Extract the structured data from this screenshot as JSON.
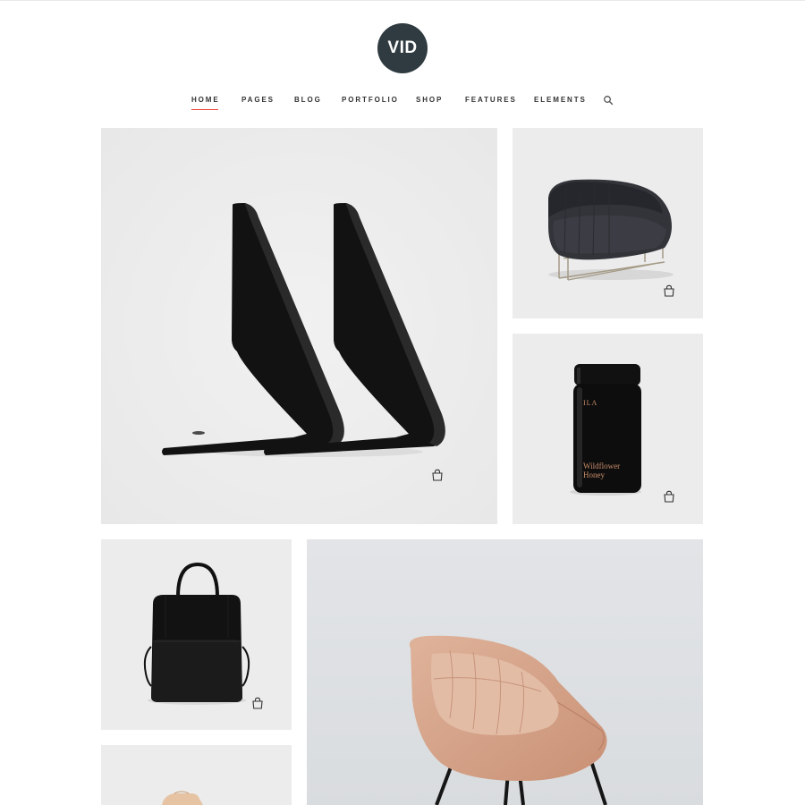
{
  "brand": {
    "logo_text": "VID",
    "logo_color": "#2f3b40"
  },
  "nav": {
    "items": [
      {
        "label": "HOME",
        "active": true
      },
      {
        "label": "PAGES",
        "active": false
      },
      {
        "label": "BLOG",
        "active": false
      },
      {
        "label": "PORTFOLIO",
        "active": false
      },
      {
        "label": "SHOP",
        "active": false
      },
      {
        "label": "FEATURES",
        "active": false
      },
      {
        "label": "ELEMENTS",
        "active": false
      }
    ],
    "active_underline_color": "#e84b3c",
    "search_icon": "search-icon"
  },
  "products": [
    {
      "name": "black-bookends",
      "icon": "shopping-bag-icon"
    },
    {
      "name": "dark-armchair",
      "icon": "shopping-bag-icon"
    },
    {
      "name": "honey-jar",
      "icon": "shopping-bag-icon",
      "jar_label": {
        "brand": "ILA",
        "line1": "Wildflower",
        "line2": "Honey"
      }
    },
    {
      "name": "black-backpack",
      "icon": "shopping-bag-icon"
    },
    {
      "name": "pink-lounge-chair"
    },
    {
      "name": "wooden-sandal"
    }
  ],
  "colors": {
    "tile_bg": "#ebebeb",
    "jar_label_text": "#c98d6b",
    "chair_pink": "#d9a98e"
  }
}
